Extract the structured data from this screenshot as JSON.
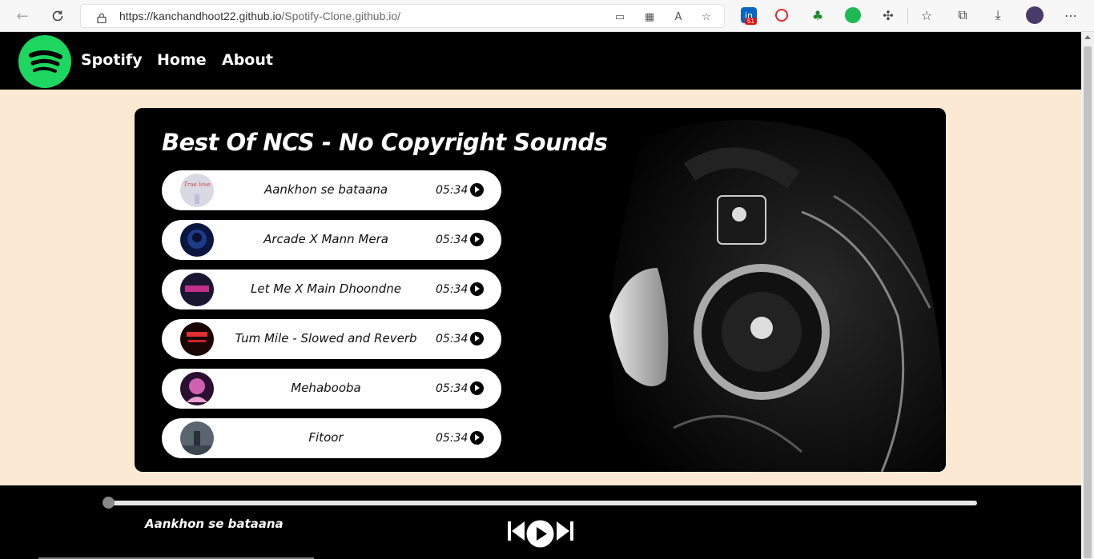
{
  "browser": {
    "url_host": "https://kanchandhoot22.github.io",
    "url_path": "/Spotify-Clone.github.io/",
    "badge_count": "51"
  },
  "nav": {
    "brand": "Spotify",
    "links": [
      "Home",
      "About"
    ]
  },
  "playlist": {
    "title": "Best Of NCS - No Copyright Sounds",
    "songs": [
      {
        "name": "Aankhon se bataana",
        "time": "05:34",
        "cover_color": "#d8d8e0"
      },
      {
        "name": "Arcade X Mann Mera",
        "time": "05:34",
        "cover_color": "#0d1a4a"
      },
      {
        "name": "Let Me X Main Dhoondne",
        "time": "05:34",
        "cover_color": "#1a1630"
      },
      {
        "name": "Tum Mile - Slowed and Reverb",
        "time": "05:34",
        "cover_color": "#2a0a0a"
      },
      {
        "name": "Mehabooba",
        "time": "05:34",
        "cover_color": "#3a1540"
      },
      {
        "name": "Fitoor",
        "time": "05:34",
        "cover_color": "#4a5560"
      }
    ]
  },
  "player": {
    "now_playing": "Aankhon se bataana",
    "progress": 0
  },
  "colors": {
    "brand_green": "#1ed760",
    "page_bg": "#fbe9d4",
    "panel_bg": "#000000"
  }
}
